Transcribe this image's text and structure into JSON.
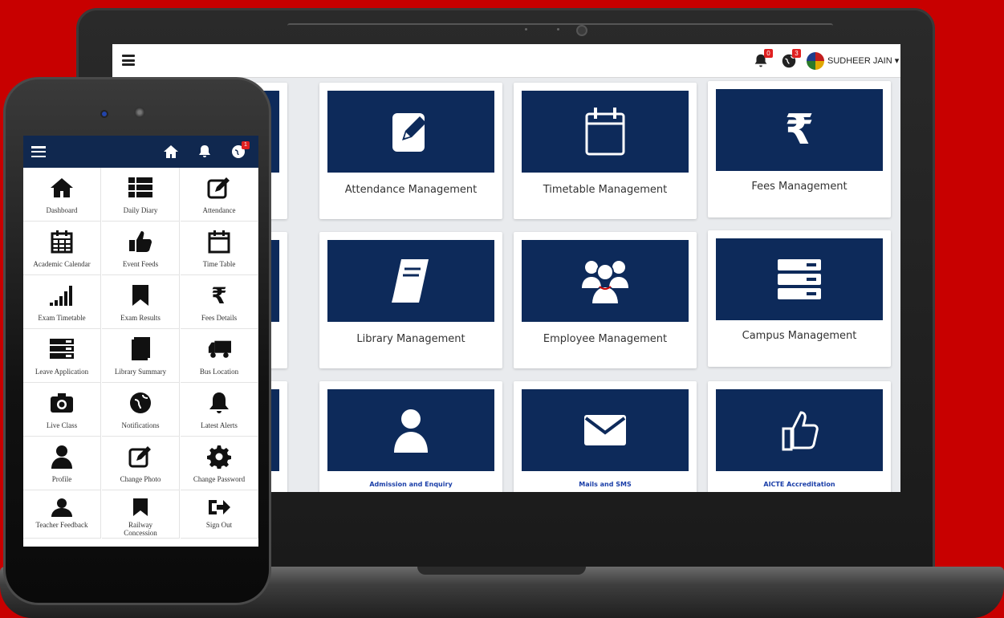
{
  "laptop": {
    "topbar": {
      "user_name": "SUDHEER JAIN",
      "user_caret": "▾",
      "notification_count": "0",
      "message_count": "3"
    },
    "cards": [
      {
        "label": "",
        "icon": "hidden-icon"
      },
      {
        "label": "Attendance Management",
        "icon": "edit-icon"
      },
      {
        "label": "Timetable Management",
        "icon": "calendar-icon"
      },
      {
        "label": "Fees Management",
        "icon": "rupee-icon"
      },
      {
        "label": "",
        "icon": "hidden-icon"
      },
      {
        "label": "Library Management",
        "icon": "book-icon"
      },
      {
        "label": "Employee Management",
        "icon": "users-icon"
      },
      {
        "label": "Campus Management",
        "icon": "server-icon"
      },
      {
        "label": "",
        "icon": "hidden-icon"
      },
      {
        "label": "Admission and Enquiry",
        "icon": "user-icon"
      },
      {
        "label": "Mails and SMS",
        "icon": "envelope-icon"
      },
      {
        "label": "AICTE Accreditation",
        "icon": "thumbs-up-icon"
      }
    ]
  },
  "phone": {
    "header": {
      "alert_count": "1"
    },
    "items": [
      {
        "label": "Dashboard",
        "icon": "home-icon"
      },
      {
        "label": "Daily Diary",
        "icon": "list-icon"
      },
      {
        "label": "Attendance",
        "icon": "edit-icon"
      },
      {
        "label": "Academic Calendar",
        "icon": "calendar-grid-icon"
      },
      {
        "label": "Event Feeds",
        "icon": "thumbs-up-icon"
      },
      {
        "label": "Time Table",
        "icon": "calendar-icon"
      },
      {
        "label": "Exam Timetable",
        "icon": "signal-icon"
      },
      {
        "label": "Exam Results",
        "icon": "bookmark-icon"
      },
      {
        "label": "Fees Details",
        "icon": "rupee-icon"
      },
      {
        "label": "Leave Application",
        "icon": "server-icon"
      },
      {
        "label": "Library Summary",
        "icon": "book-icon"
      },
      {
        "label": "Bus Location",
        "icon": "truck-icon"
      },
      {
        "label": "Live Class",
        "icon": "camera-icon"
      },
      {
        "label": "Notifications",
        "icon": "globe-icon"
      },
      {
        "label": "Latest Alerts",
        "icon": "bell-icon"
      },
      {
        "label": "Profile",
        "icon": "user-icon"
      },
      {
        "label": "Change Photo",
        "icon": "edit-icon"
      },
      {
        "label": "Change Password",
        "icon": "gear-icon"
      },
      {
        "label": "Teacher Feedback",
        "icon": "user-icon"
      },
      {
        "label": "Railway Concession",
        "icon": "bookmark-icon"
      },
      {
        "label": "Sign Out",
        "icon": "sign-out-icon"
      }
    ]
  },
  "colors": {
    "background": "#c80000",
    "tile": "#0d2a5a",
    "phone_header": "#10284f",
    "badge": "#e02020"
  }
}
